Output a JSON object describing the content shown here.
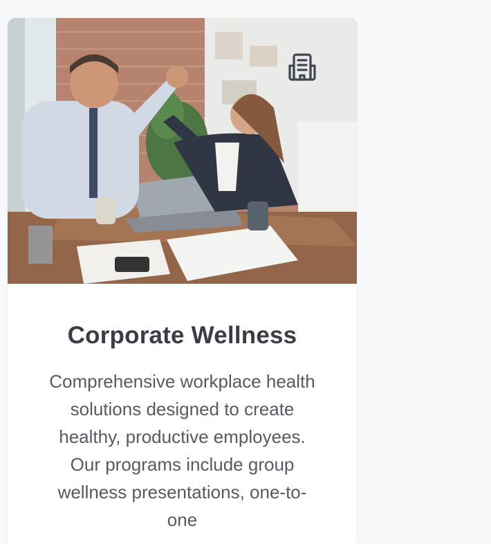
{
  "card": {
    "title": "Corporate Wellness",
    "description": "Comprehensive workplace health solutions designed to create healthy, productive employees. Our programs include group wellness presentations, one-to-one",
    "icon": "office-building-icon",
    "image": "business-team-high-five-photo"
  },
  "colors": {
    "title": "#3a3d45",
    "description": "#555a63",
    "card_background": "#ffffff",
    "page_background": "#f8f9fa"
  }
}
